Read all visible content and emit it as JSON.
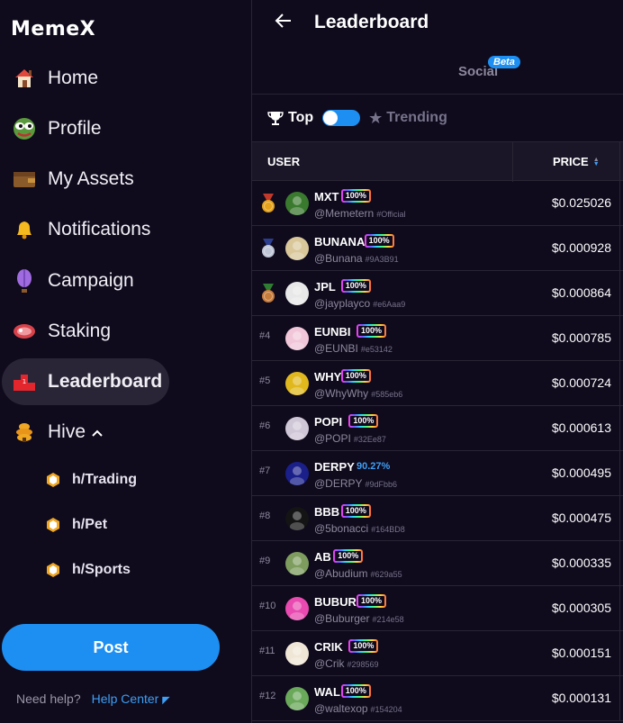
{
  "app": {
    "logo": "MemeX"
  },
  "sidebar": {
    "items": [
      {
        "label": "Home",
        "icon": "house-icon"
      },
      {
        "label": "Profile",
        "icon": "pepe-face-icon"
      },
      {
        "label": "My Assets",
        "icon": "wallet-icon"
      },
      {
        "label": "Notifications",
        "icon": "bell-icon"
      },
      {
        "label": "Campaign",
        "icon": "balloon-icon"
      },
      {
        "label": "Staking",
        "icon": "steak-icon"
      },
      {
        "label": "Leaderboard",
        "icon": "podium-icon",
        "active": true
      },
      {
        "label": "Hive",
        "icon": "beehive-icon",
        "expanded": true
      }
    ],
    "hive_items": [
      {
        "label": "h/Trading"
      },
      {
        "label": "h/Pet"
      },
      {
        "label": "h/Sports"
      }
    ],
    "post_label": "Post",
    "help_text": "Need help?",
    "help_link": "Help Center"
  },
  "header": {
    "title": "Leaderboard",
    "tab": "Social",
    "tab_badge": "Beta"
  },
  "filters": {
    "top_label": "Top",
    "trending_label": "Trending",
    "toggle_on": true
  },
  "table": {
    "col_user": "USER",
    "col_price": "PRICE",
    "rows": [
      {
        "rank": "",
        "medal": "gold",
        "name": "MXT",
        "pct": "100%",
        "handle": "@Memetern",
        "hash": "#Official",
        "price": "$0.025026",
        "avatar_color": "#3a7a2e"
      },
      {
        "rank": "",
        "medal": "silver",
        "name": "BUNANA",
        "pct": "100%",
        "handle": "@Bunana",
        "hash": "#9A3B91",
        "price": "$0.000928",
        "avatar_color": "#d9c79a"
      },
      {
        "rank": "",
        "medal": "bronze",
        "name": "JPL",
        "pct": "100%",
        "handle": "@jayplayco",
        "hash": "#e6Aaa9",
        "price": "$0.000864",
        "avatar_color": "#e8e8e8"
      },
      {
        "rank": "#4",
        "name": "EUNBI",
        "pct": "100%",
        "handle": "@EUNBI",
        "hash": "#e53142",
        "price": "$0.000785",
        "avatar_color": "#f1c6d8"
      },
      {
        "rank": "#5",
        "name": "WHY",
        "pct": "100%",
        "handle": "@WhyWhy",
        "hash": "#585eb6",
        "price": "$0.000724",
        "avatar_color": "#e0b81e"
      },
      {
        "rank": "#6",
        "name": "POPI",
        "pct": "100%",
        "handle": "@POPI",
        "hash": "#32Ee87",
        "price": "$0.000613",
        "avatar_color": "#cfc6d6"
      },
      {
        "rank": "#7",
        "name": "DERPY",
        "pct": "90.27%",
        "plain": true,
        "handle": "@DERPY",
        "hash": "#9dFbb6",
        "price": "$0.000495",
        "avatar_color": "#1a1f8a"
      },
      {
        "rank": "#8",
        "name": "BBB",
        "pct": "100%",
        "handle": "@5bonacci",
        "hash": "#164BD8",
        "price": "$0.000475",
        "avatar_color": "#141414"
      },
      {
        "rank": "#9",
        "name": "AB",
        "pct": "100%",
        "handle": "@Abudium",
        "hash": "#629a55",
        "price": "$0.000335",
        "avatar_color": "#7d9c5e"
      },
      {
        "rank": "#10",
        "name": "BUBUR",
        "pct": "100%",
        "handle": "@Buburger",
        "hash": "#214e58",
        "price": "$0.000305",
        "avatar_color": "#e84ab0"
      },
      {
        "rank": "#11",
        "name": "CRIK",
        "pct": "100%",
        "handle": "@Crik",
        "hash": "#298569",
        "price": "$0.000151",
        "avatar_color": "#efe6d6"
      },
      {
        "rank": "#12",
        "name": "WAL",
        "pct": "100%",
        "handle": "@waltexop",
        "hash": "#154204",
        "price": "$0.000131",
        "avatar_color": "#6aa85a"
      }
    ]
  }
}
